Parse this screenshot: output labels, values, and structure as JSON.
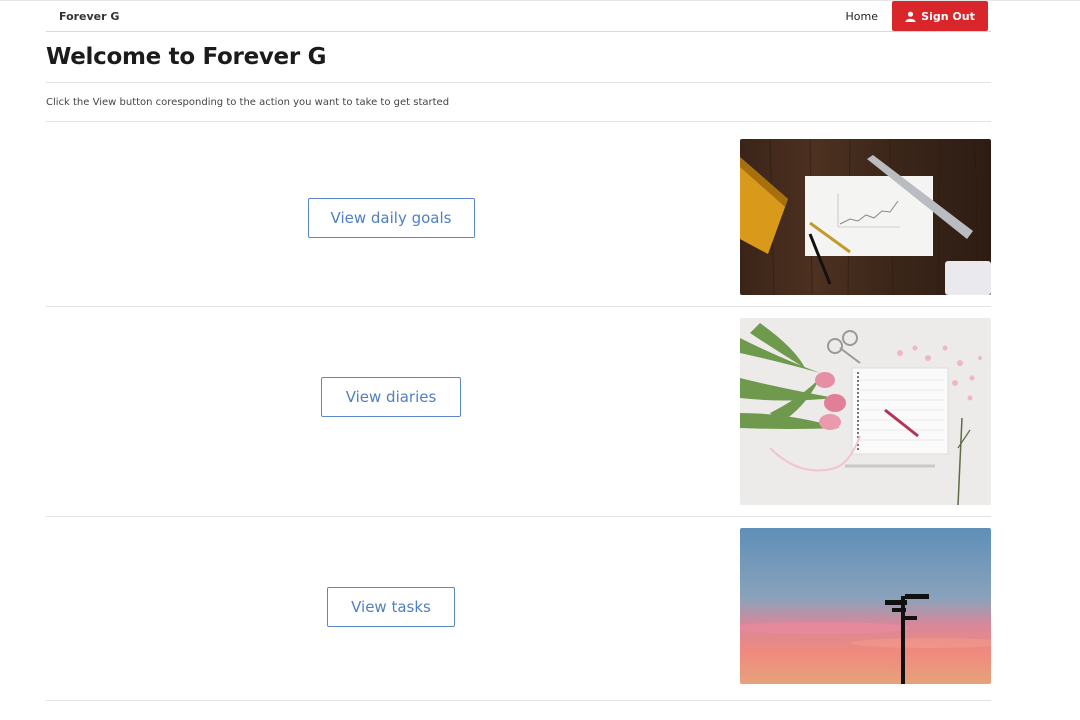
{
  "navbar": {
    "brand": "Forever G",
    "home_label": "Home",
    "signout_label": "Sign Out"
  },
  "page": {
    "title": "Welcome to Forever G",
    "intro": "Click the View button coresponding to the action you want to take to get started"
  },
  "actions": [
    {
      "button_label": "View daily goals",
      "image": "desk-notebook-chart-ruler-photo"
    },
    {
      "button_label": "View diaries",
      "image": "tulips-notebook-scissors-photo"
    },
    {
      "button_label": "View tasks",
      "image": "sunset-signpost-silhouette-photo"
    }
  ],
  "colors": {
    "signout_bg": "#d9262b",
    "button_border": "#5b88c9",
    "button_text": "#4f7fc4"
  }
}
